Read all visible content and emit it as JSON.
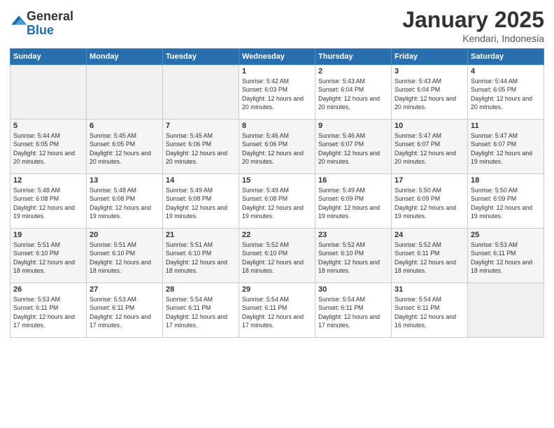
{
  "logo": {
    "general": "General",
    "blue": "Blue"
  },
  "header": {
    "title": "January 2025",
    "subtitle": "Kendari, Indonesia"
  },
  "weekdays": [
    "Sunday",
    "Monday",
    "Tuesday",
    "Wednesday",
    "Thursday",
    "Friday",
    "Saturday"
  ],
  "weeks": [
    [
      {
        "day": "",
        "sunrise": "",
        "sunset": "",
        "daylight": ""
      },
      {
        "day": "",
        "sunrise": "",
        "sunset": "",
        "daylight": ""
      },
      {
        "day": "",
        "sunrise": "",
        "sunset": "",
        "daylight": ""
      },
      {
        "day": "1",
        "sunrise": "Sunrise: 5:42 AM",
        "sunset": "Sunset: 6:03 PM",
        "daylight": "Daylight: 12 hours and 20 minutes."
      },
      {
        "day": "2",
        "sunrise": "Sunrise: 5:43 AM",
        "sunset": "Sunset: 6:04 PM",
        "daylight": "Daylight: 12 hours and 20 minutes."
      },
      {
        "day": "3",
        "sunrise": "Sunrise: 5:43 AM",
        "sunset": "Sunset: 6:04 PM",
        "daylight": "Daylight: 12 hours and 20 minutes."
      },
      {
        "day": "4",
        "sunrise": "Sunrise: 5:44 AM",
        "sunset": "Sunset: 6:05 PM",
        "daylight": "Daylight: 12 hours and 20 minutes."
      }
    ],
    [
      {
        "day": "5",
        "sunrise": "Sunrise: 5:44 AM",
        "sunset": "Sunset: 6:05 PM",
        "daylight": "Daylight: 12 hours and 20 minutes."
      },
      {
        "day": "6",
        "sunrise": "Sunrise: 5:45 AM",
        "sunset": "Sunset: 6:05 PM",
        "daylight": "Daylight: 12 hours and 20 minutes."
      },
      {
        "day": "7",
        "sunrise": "Sunrise: 5:45 AM",
        "sunset": "Sunset: 6:06 PM",
        "daylight": "Daylight: 12 hours and 20 minutes."
      },
      {
        "day": "8",
        "sunrise": "Sunrise: 5:46 AM",
        "sunset": "Sunset: 6:06 PM",
        "daylight": "Daylight: 12 hours and 20 minutes."
      },
      {
        "day": "9",
        "sunrise": "Sunrise: 5:46 AM",
        "sunset": "Sunset: 6:07 PM",
        "daylight": "Daylight: 12 hours and 20 minutes."
      },
      {
        "day": "10",
        "sunrise": "Sunrise: 5:47 AM",
        "sunset": "Sunset: 6:07 PM",
        "daylight": "Daylight: 12 hours and 20 minutes."
      },
      {
        "day": "11",
        "sunrise": "Sunrise: 5:47 AM",
        "sunset": "Sunset: 6:07 PM",
        "daylight": "Daylight: 12 hours and 19 minutes."
      }
    ],
    [
      {
        "day": "12",
        "sunrise": "Sunrise: 5:48 AM",
        "sunset": "Sunset: 6:08 PM",
        "daylight": "Daylight: 12 hours and 19 minutes."
      },
      {
        "day": "13",
        "sunrise": "Sunrise: 5:48 AM",
        "sunset": "Sunset: 6:08 PM",
        "daylight": "Daylight: 12 hours and 19 minutes."
      },
      {
        "day": "14",
        "sunrise": "Sunrise: 5:49 AM",
        "sunset": "Sunset: 6:08 PM",
        "daylight": "Daylight: 12 hours and 19 minutes."
      },
      {
        "day": "15",
        "sunrise": "Sunrise: 5:49 AM",
        "sunset": "Sunset: 6:08 PM",
        "daylight": "Daylight: 12 hours and 19 minutes."
      },
      {
        "day": "16",
        "sunrise": "Sunrise: 5:49 AM",
        "sunset": "Sunset: 6:09 PM",
        "daylight": "Daylight: 12 hours and 19 minutes."
      },
      {
        "day": "17",
        "sunrise": "Sunrise: 5:50 AM",
        "sunset": "Sunset: 6:09 PM",
        "daylight": "Daylight: 12 hours and 19 minutes."
      },
      {
        "day": "18",
        "sunrise": "Sunrise: 5:50 AM",
        "sunset": "Sunset: 6:09 PM",
        "daylight": "Daylight: 12 hours and 19 minutes."
      }
    ],
    [
      {
        "day": "19",
        "sunrise": "Sunrise: 5:51 AM",
        "sunset": "Sunset: 6:10 PM",
        "daylight": "Daylight: 12 hours and 18 minutes."
      },
      {
        "day": "20",
        "sunrise": "Sunrise: 5:51 AM",
        "sunset": "Sunset: 6:10 PM",
        "daylight": "Daylight: 12 hours and 18 minutes."
      },
      {
        "day": "21",
        "sunrise": "Sunrise: 5:51 AM",
        "sunset": "Sunset: 6:10 PM",
        "daylight": "Daylight: 12 hours and 18 minutes."
      },
      {
        "day": "22",
        "sunrise": "Sunrise: 5:52 AM",
        "sunset": "Sunset: 6:10 PM",
        "daylight": "Daylight: 12 hours and 18 minutes."
      },
      {
        "day": "23",
        "sunrise": "Sunrise: 5:52 AM",
        "sunset": "Sunset: 6:10 PM",
        "daylight": "Daylight: 12 hours and 18 minutes."
      },
      {
        "day": "24",
        "sunrise": "Sunrise: 5:52 AM",
        "sunset": "Sunset: 6:11 PM",
        "daylight": "Daylight: 12 hours and 18 minutes."
      },
      {
        "day": "25",
        "sunrise": "Sunrise: 5:53 AM",
        "sunset": "Sunset: 6:11 PM",
        "daylight": "Daylight: 12 hours and 18 minutes."
      }
    ],
    [
      {
        "day": "26",
        "sunrise": "Sunrise: 5:53 AM",
        "sunset": "Sunset: 6:11 PM",
        "daylight": "Daylight: 12 hours and 17 minutes."
      },
      {
        "day": "27",
        "sunrise": "Sunrise: 5:53 AM",
        "sunset": "Sunset: 6:11 PM",
        "daylight": "Daylight: 12 hours and 17 minutes."
      },
      {
        "day": "28",
        "sunrise": "Sunrise: 5:54 AM",
        "sunset": "Sunset: 6:11 PM",
        "daylight": "Daylight: 12 hours and 17 minutes."
      },
      {
        "day": "29",
        "sunrise": "Sunrise: 5:54 AM",
        "sunset": "Sunset: 6:11 PM",
        "daylight": "Daylight: 12 hours and 17 minutes."
      },
      {
        "day": "30",
        "sunrise": "Sunrise: 5:54 AM",
        "sunset": "Sunset: 6:11 PM",
        "daylight": "Daylight: 12 hours and 17 minutes."
      },
      {
        "day": "31",
        "sunrise": "Sunrise: 5:54 AM",
        "sunset": "Sunset: 6:11 PM",
        "daylight": "Daylight: 12 hours and 16 minutes."
      },
      {
        "day": "",
        "sunrise": "",
        "sunset": "",
        "daylight": ""
      }
    ]
  ]
}
